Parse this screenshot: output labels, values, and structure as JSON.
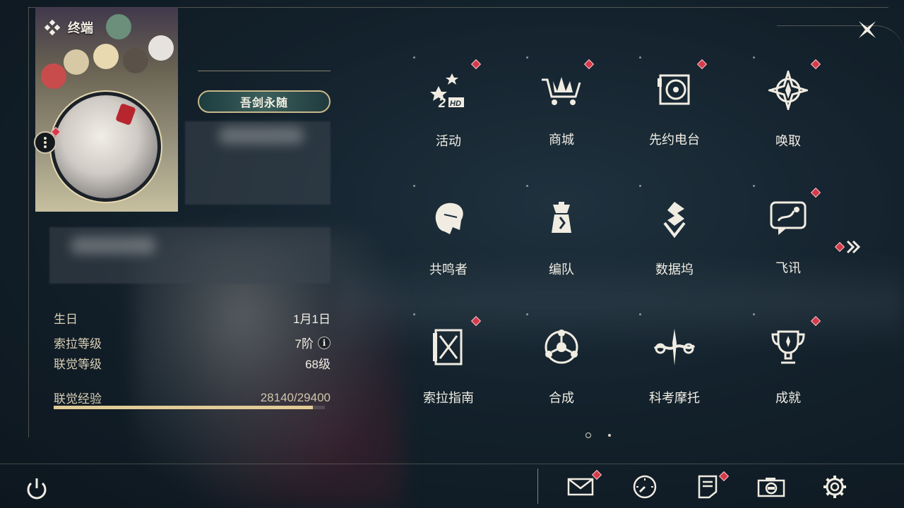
{
  "header": {
    "title": "终端"
  },
  "profile": {
    "player_title": "吾剑永随",
    "stats": [
      {
        "label": "生日",
        "value": "1月1日"
      },
      {
        "label": "索拉等级",
        "value": "7阶"
      },
      {
        "label": "联觉等级",
        "value": "68级"
      }
    ],
    "xp": {
      "label": "联觉经验",
      "value": "28140/29400",
      "fraction": 0.957
    }
  },
  "menu": {
    "items": [
      {
        "label": "活动",
        "icon": "event-icon",
        "badge": true
      },
      {
        "label": "商城",
        "icon": "shop-icon",
        "badge": true
      },
      {
        "label": "先约电台",
        "icon": "radio-icon",
        "badge": true
      },
      {
        "label": "唤取",
        "icon": "convene-icon",
        "badge": true
      },
      {
        "label": "共鸣者",
        "icon": "resonator-icon",
        "badge": false
      },
      {
        "label": "编队",
        "icon": "team-icon",
        "badge": false
      },
      {
        "label": "数据坞",
        "icon": "data-bank-icon",
        "badge": false
      },
      {
        "label": "飞讯",
        "icon": "messenger-icon",
        "badge": true
      },
      {
        "label": "索拉指南",
        "icon": "guidebook-icon",
        "badge": true
      },
      {
        "label": "合成",
        "icon": "synthesis-icon",
        "badge": false
      },
      {
        "label": "科考摩托",
        "icon": "motorcycle-icon",
        "badge": false
      },
      {
        "label": "成就",
        "icon": "achievement-icon",
        "badge": true
      }
    ],
    "page": {
      "current": 1,
      "total": 2
    }
  },
  "bottom_bar": {
    "buttons": [
      "mail-icon",
      "clock-icon",
      "notice-icon",
      "camera-icon",
      "settings-icon"
    ]
  },
  "colors": {
    "accent_gold": "#e1cb96",
    "badge_red": "#d63a4a",
    "background": "#1a2b38"
  }
}
